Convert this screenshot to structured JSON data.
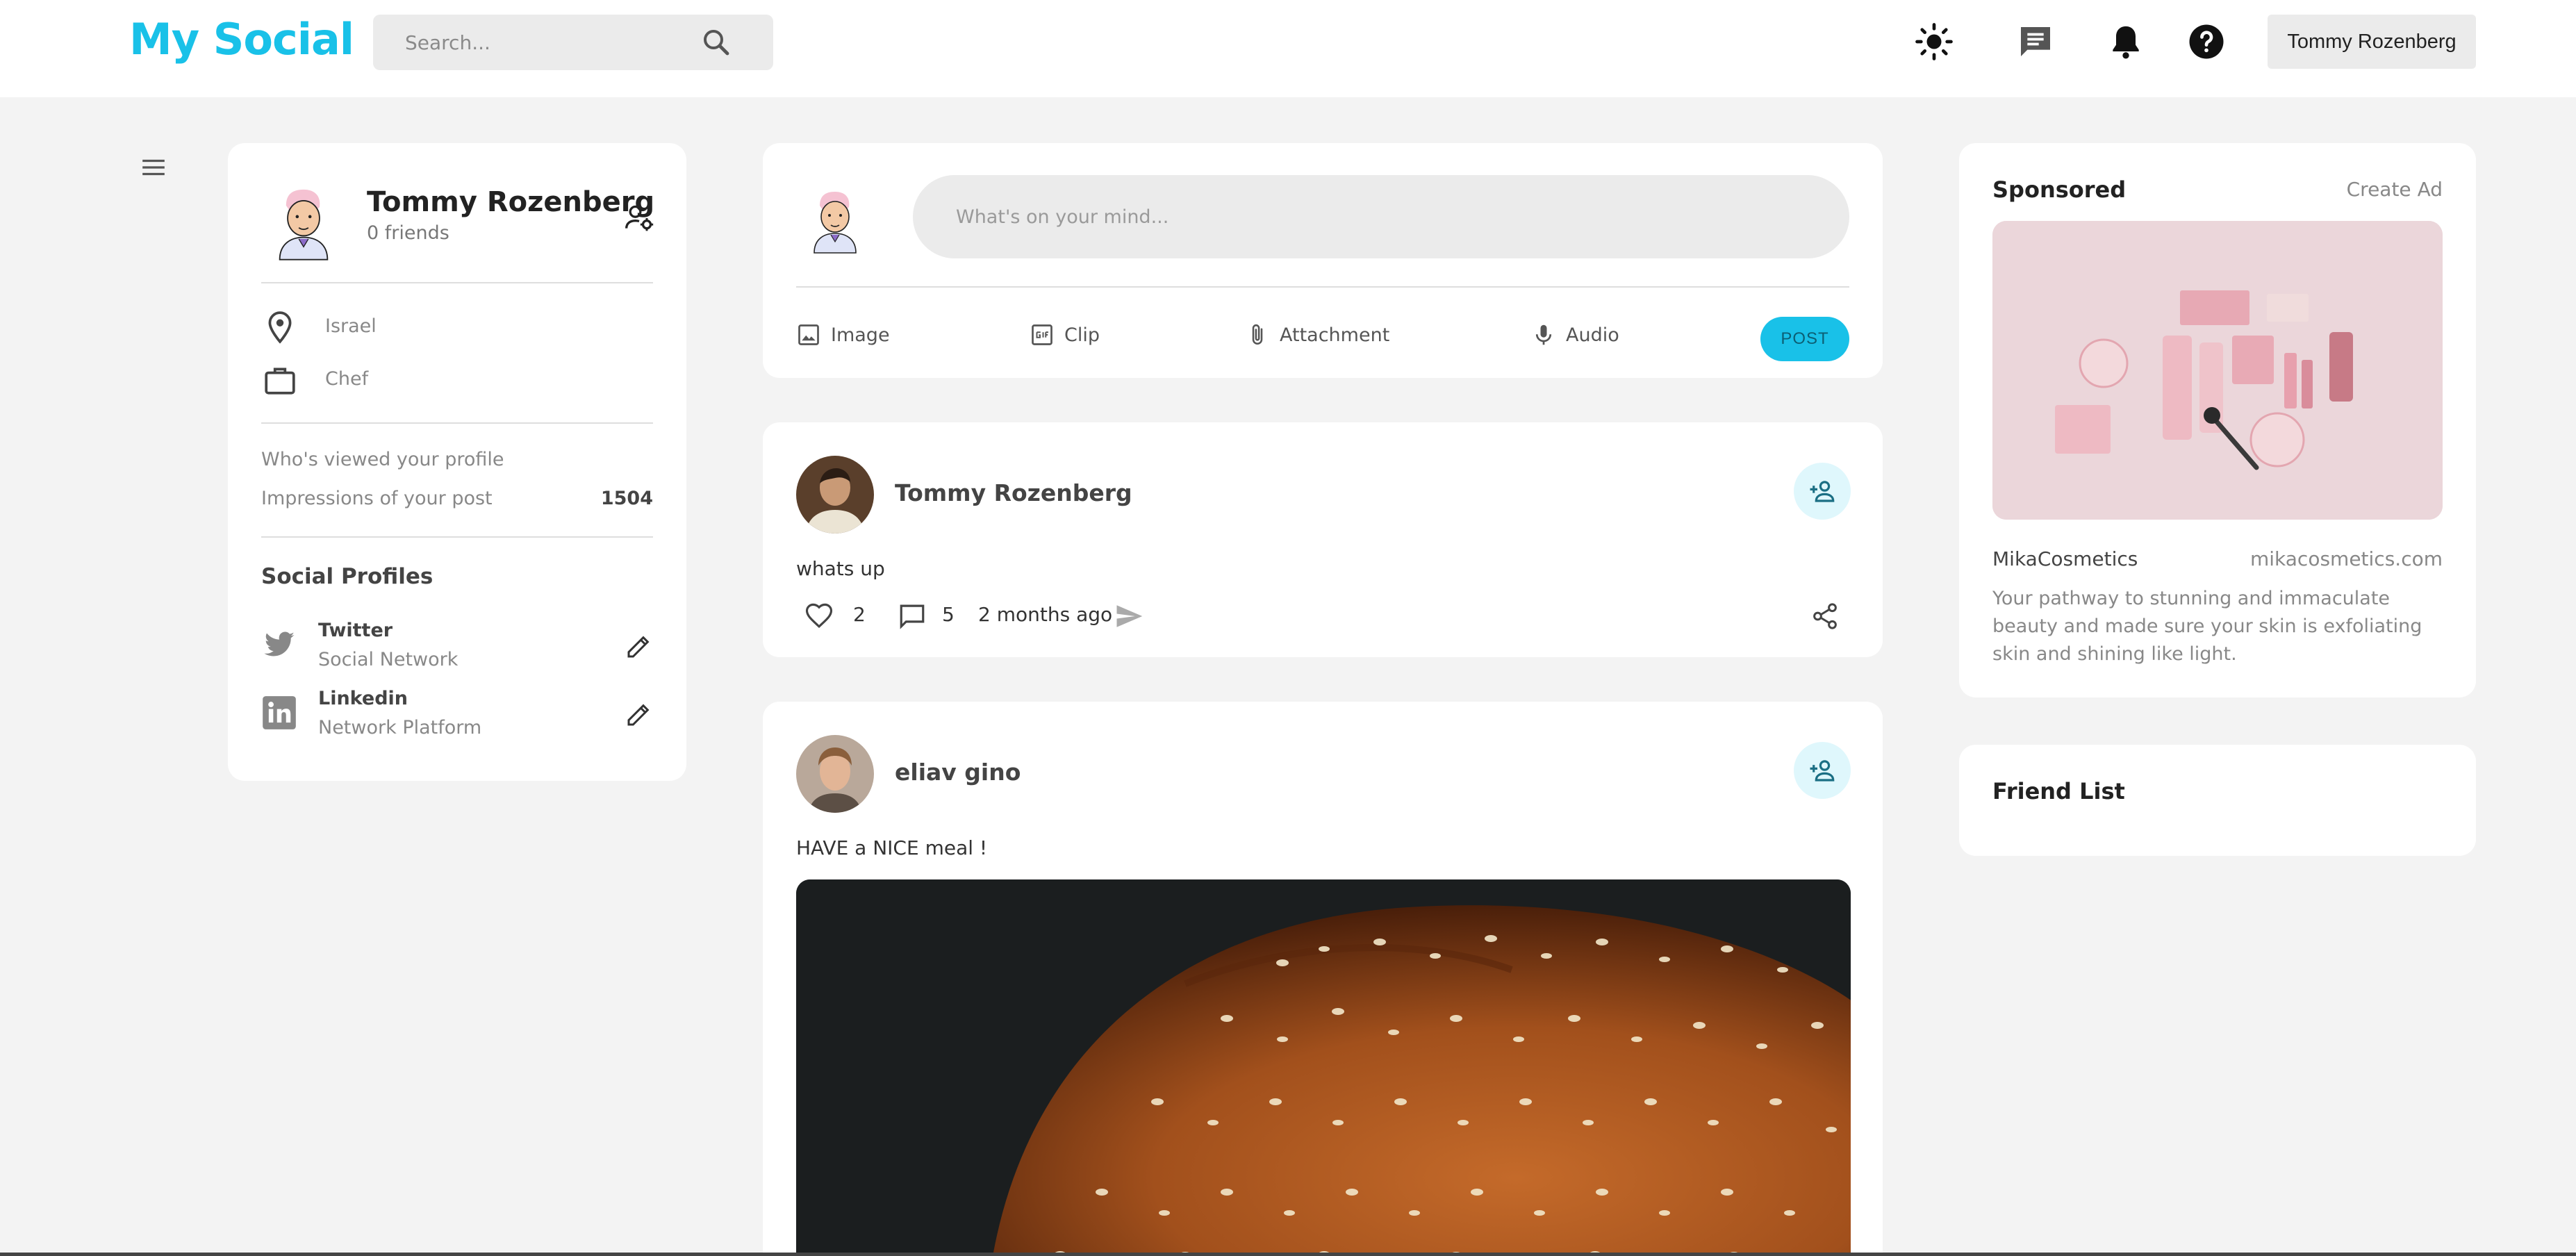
{
  "navbar": {
    "logo": "My Social",
    "search_placeholder": "Search...",
    "icons": [
      "search-icon",
      "sun-icon",
      "message-icon",
      "bell-icon",
      "help-icon"
    ],
    "user_name": "Tommy Rozenberg"
  },
  "profile": {
    "name": "Tommy Rozenberg",
    "friends": "0 friends",
    "location": "Israel",
    "occupation": "Chef",
    "stats": [
      {
        "label": "Who's viewed your profile",
        "value": ""
      },
      {
        "label": "Impressions of your post",
        "value": "1504"
      }
    ],
    "social_title": "Social Profiles",
    "socials": [
      {
        "name": "Twitter",
        "sub": "Social Network"
      },
      {
        "name": "Linkedin",
        "sub": "Network Platform"
      }
    ]
  },
  "composer": {
    "placeholder": "What's on your mind...",
    "tools": [
      "Image",
      "Clip",
      "Attachment",
      "Audio"
    ],
    "post_label": "POST"
  },
  "posts": [
    {
      "author": "Tommy Rozenberg",
      "text": "whats up",
      "likes": "2",
      "comments": "5",
      "time": "2 months ago"
    },
    {
      "author": "eliav gino",
      "text": "HAVE a NICE meal !"
    }
  ],
  "sponsored": {
    "title": "Sponsored",
    "create_ad": "Create Ad",
    "brand": "MikaCosmetics",
    "url": "mikacosmetics.com",
    "description": "Your pathway to stunning and immaculate beauty and made sure your skin is exfoliating skin and shining like light."
  },
  "friend_list": {
    "title": "Friend List"
  },
  "colors": {
    "accent": "#19c1e8",
    "background": "#f3f3f3",
    "card": "#ffffff"
  }
}
